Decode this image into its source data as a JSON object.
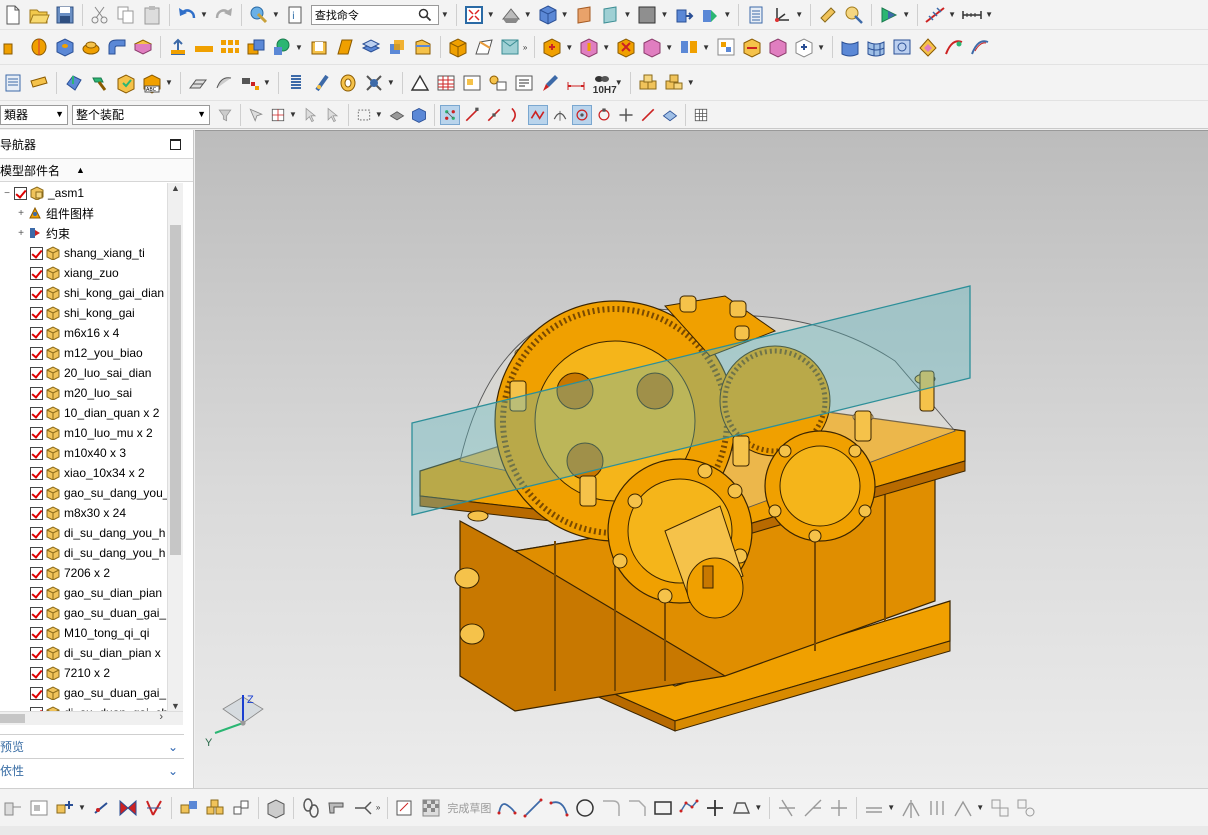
{
  "toolbar": {
    "search_placeholder": "查找命令",
    "overflow_label": "»",
    "tolerance_label": "10H7",
    "finish_sketch_label": "完成草图"
  },
  "selection_bar": {
    "filter_value": "類器",
    "scope_value": "整个装配"
  },
  "navigator": {
    "title": "导航器",
    "column_header": "模型部件名",
    "root": "_asm1",
    "groups": [
      "组件图样",
      "约束"
    ],
    "items": [
      "shang_xiang_ti",
      "xiang_zuo",
      "shi_kong_gai_dian",
      "shi_kong_gai",
      "m6x16 x 4",
      "m12_you_biao",
      "20_luo_sai_dian",
      "m20_luo_sai",
      "10_dian_quan x 2",
      "m10_luo_mu x 2",
      "m10x40 x 3",
      "xiao_10x34 x 2",
      "gao_su_dang_you_",
      "m8x30 x 24",
      "di_su_dang_you_h",
      "di_su_dang_you_h",
      "7206 x 2",
      "gao_su_dian_pian",
      "gao_su_duan_gai_",
      "M10_tong_qi_qi",
      "di_su_dian_pian x",
      "7210 x 2",
      "gao_su_duan_gai_",
      "di_su_duan_gai_ch"
    ],
    "panel_preview": "预览",
    "panel_dependencies": "依性"
  },
  "viewport": {
    "axis_z": "Z",
    "axis_y": "Y"
  },
  "colors": {
    "model_orange": "#f0a000",
    "model_dark": "#a85a00",
    "plane_teal": "#5fb8c0",
    "check_red": "#d00000"
  }
}
